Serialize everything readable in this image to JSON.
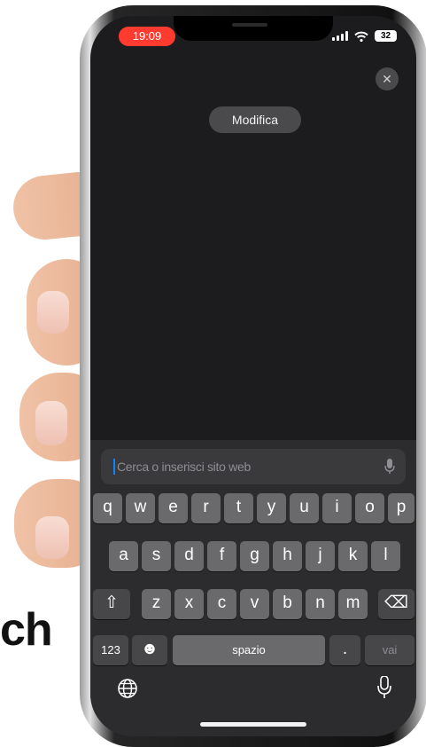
{
  "background": {
    "partial_text": "ch"
  },
  "status_bar": {
    "time": "19:09",
    "battery": "32"
  },
  "overlay": {
    "edit_label": "Modifica",
    "close_icon": "close-icon"
  },
  "search": {
    "placeholder": "Cerca o inserisci sito web"
  },
  "keyboard": {
    "row1": [
      "q",
      "w",
      "e",
      "r",
      "t",
      "y",
      "u",
      "i",
      "o",
      "p"
    ],
    "row2": [
      "a",
      "s",
      "d",
      "f",
      "g",
      "h",
      "j",
      "k",
      "l"
    ],
    "row3": [
      "z",
      "x",
      "c",
      "v",
      "b",
      "n",
      "m"
    ],
    "shift_symbol": "⇧",
    "delete_symbol": "⌫",
    "numbers_label": "123",
    "emoji_symbol": "☻",
    "space_label": "spazio",
    "period_label": ".",
    "go_label": "vai"
  },
  "colors": {
    "accent": "#0a84ff",
    "time_pill": "#ff3b30",
    "screen_bg": "#1c1c1e"
  }
}
